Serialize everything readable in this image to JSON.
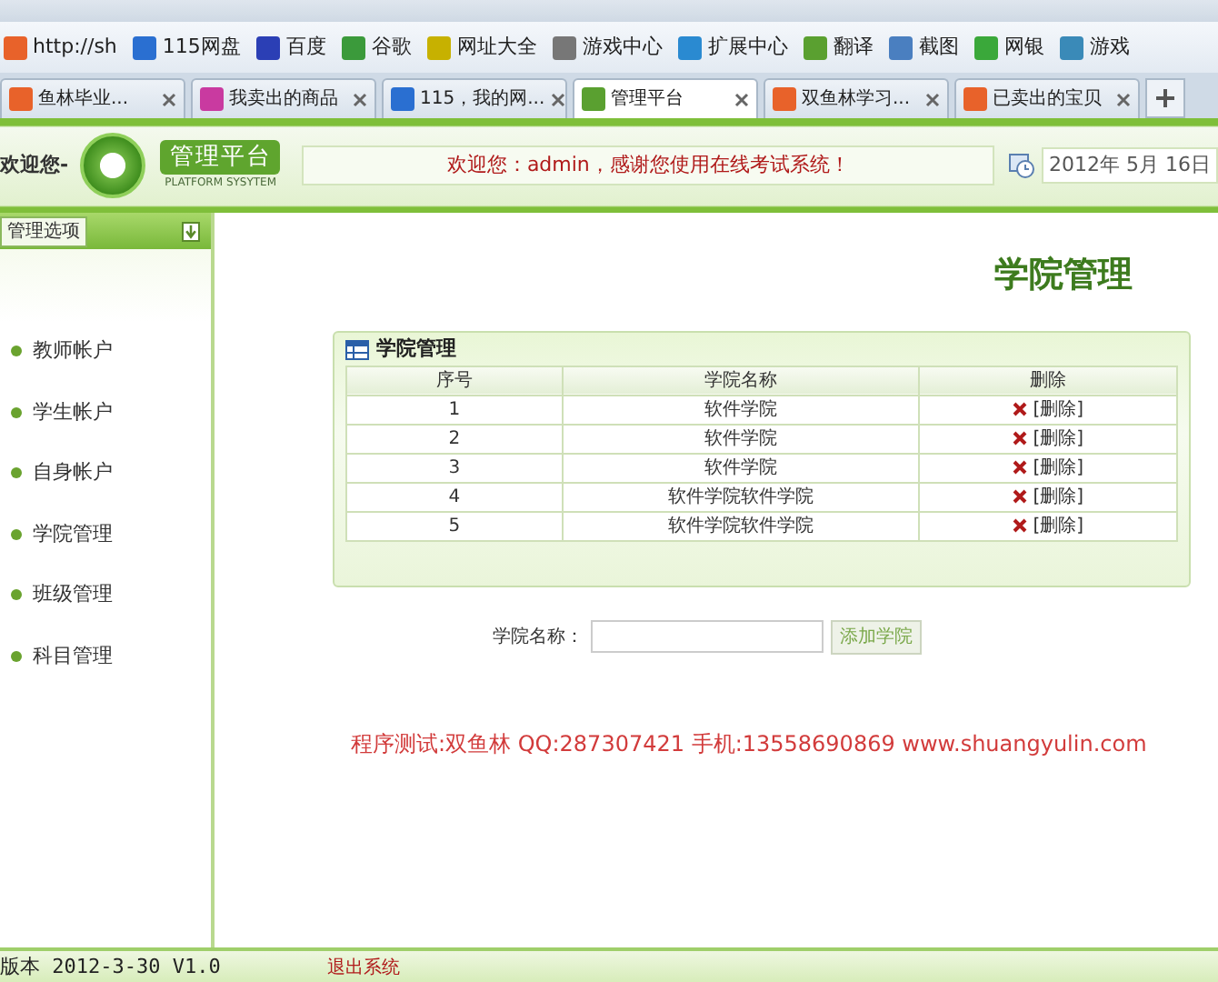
{
  "browser": {
    "bookmarks": [
      {
        "label": "http://sh",
        "color": "#e8622a"
      },
      {
        "label": "115网盘",
        "color": "#2a6fd1"
      },
      {
        "label": "百度",
        "color": "#2b3fb5"
      },
      {
        "label": "谷歌",
        "color": "#3b9a3b"
      },
      {
        "label": "网址大全",
        "color": "#c7b100"
      },
      {
        "label": "游戏中心",
        "color": "#777777"
      },
      {
        "label": "扩展中心",
        "color": "#2a8ad1"
      },
      {
        "label": "翻译",
        "color": "#5aa030"
      },
      {
        "label": "截图",
        "color": "#4a7fc0"
      },
      {
        "label": "网银",
        "color": "#3aa83a"
      },
      {
        "label": "游戏",
        "color": "#3a8ab8"
      }
    ],
    "tabs": [
      {
        "label": "鱼林毕业...",
        "selected": false,
        "color": "#e8622a"
      },
      {
        "label": "我卖出的商品",
        "selected": false,
        "color": "#c93aa0"
      },
      {
        "label": "115，我的网...",
        "selected": false,
        "color": "#2a6fd1"
      },
      {
        "label": "管理平台",
        "selected": true,
        "color": "#5aa030"
      },
      {
        "label": "双鱼林学习...",
        "selected": false,
        "color": "#e8622a"
      },
      {
        "label": "已卖出的宝贝",
        "selected": false,
        "color": "#e8622a"
      }
    ]
  },
  "header": {
    "welcome": "欢迎您-",
    "logo_title": "管理平台",
    "logo_subtitle": "PLATFORM SYSYTEM",
    "message": "欢迎您：admin，感谢您使用在线考试系统！",
    "date": "2012年 5月 16日"
  },
  "sidebar": {
    "title": "管理选项",
    "items": [
      "教师帐户",
      "学生帐户",
      "自身帐户",
      "学院管理",
      "班级管理",
      "科目管理"
    ]
  },
  "main": {
    "title": "学院管理",
    "panel": {
      "title": "学院管理",
      "columns": [
        "序号",
        "学院名称",
        "删除"
      ],
      "rows": [
        {
          "index": "1",
          "name": "软件学院",
          "action": "[删除]"
        },
        {
          "index": "2",
          "name": "软件学院",
          "action": "[删除]"
        },
        {
          "index": "3",
          "name": "软件学院",
          "action": "[删除]"
        },
        {
          "index": "4",
          "name": "软件学院软件学院",
          "action": "[删除]"
        },
        {
          "index": "5",
          "name": "软件学院软件学院",
          "action": "[删除]"
        }
      ]
    },
    "form": {
      "label": "学院名称：",
      "button": "添加学院"
    },
    "credit": "程序测试:双鱼林 QQ:287307421 手机:13558690869 www.shuangyulin.com"
  },
  "footer": {
    "version": "版本 2012-3-30 V1.0",
    "logout": "退出系统"
  }
}
